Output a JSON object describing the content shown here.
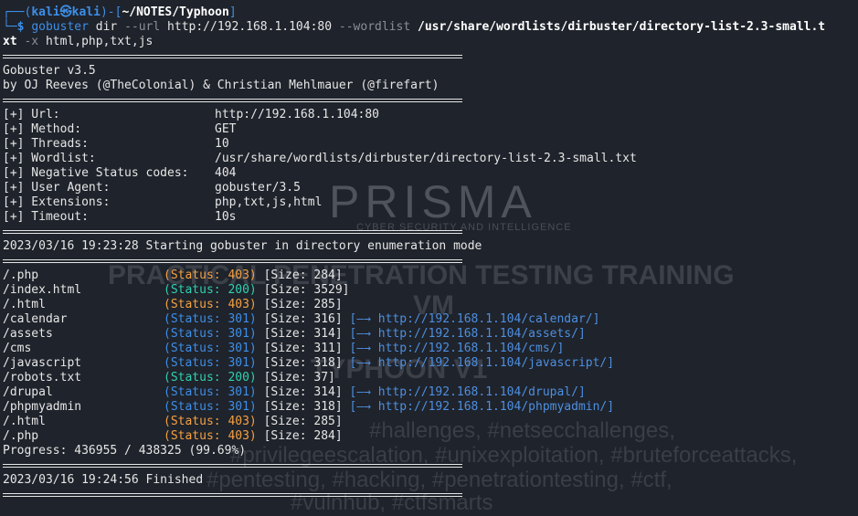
{
  "prompt": {
    "corner_top": "┌──(",
    "user": "kali",
    "at": "㉿",
    "host": "kali",
    "mid": ")-[",
    "path": "~/NOTES/Typhoon",
    "end": "]",
    "corner_bottom": "└─",
    "dollar": "$",
    "cmd": "gobuster",
    "arg1": "dir",
    "flag_url": "--url",
    "url": "http://192.168.1.104:80",
    "flag_wordlist": "--wordlist",
    "wordlist_part1": "/usr/share/wordlists/dirbuster/directory-list-2.3-small.t",
    "wordlist_part2": "xt",
    "flag_x": "-x",
    "ext": "html,php,txt,js"
  },
  "banner": {
    "version": "Gobuster v3.5",
    "authors": "by OJ Reeves (@TheColonial) & Christian Mehlmauer (@firefart)"
  },
  "config": [
    {
      "key": "[+] Url:",
      "value": "http://192.168.1.104:80"
    },
    {
      "key": "[+] Method:",
      "value": "GET"
    },
    {
      "key": "[+] Threads:",
      "value": "10"
    },
    {
      "key": "[+] Wordlist:",
      "value": "/usr/share/wordlists/dirbuster/directory-list-2.3-small.txt"
    },
    {
      "key": "[+] Negative Status codes:",
      "value": "404"
    },
    {
      "key": "[+] User Agent:",
      "value": "gobuster/3.5"
    },
    {
      "key": "[+] Extensions:",
      "value": "php,txt,js,html"
    },
    {
      "key": "[+] Timeout:",
      "value": "10s"
    }
  ],
  "start_msg": "2023/03/16 19:23:28 Starting gobuster in directory enumeration mode",
  "results": [
    {
      "path": "/.php",
      "status": "(Status: 403)",
      "size": "[Size: 284]",
      "code": "403",
      "redirect": ""
    },
    {
      "path": "/index.html",
      "status": "(Status: 200)",
      "size": "[Size: 3529]",
      "code": "200",
      "redirect": ""
    },
    {
      "path": "/.html",
      "status": "(Status: 403)",
      "size": "[Size: 285]",
      "code": "403",
      "redirect": ""
    },
    {
      "path": "/calendar",
      "status": "(Status: 301)",
      "size": "[Size: 316]",
      "code": "301",
      "redirect": "[—→ http://192.168.1.104/calendar/]"
    },
    {
      "path": "/assets",
      "status": "(Status: 301)",
      "size": "[Size: 314]",
      "code": "301",
      "redirect": "[—→ http://192.168.1.104/assets/]"
    },
    {
      "path": "/cms",
      "status": "(Status: 301)",
      "size": "[Size: 311]",
      "code": "301",
      "redirect": "[—→ http://192.168.1.104/cms/]"
    },
    {
      "path": "/javascript",
      "status": "(Status: 301)",
      "size": "[Size: 318]",
      "code": "301",
      "redirect": "[—→ http://192.168.1.104/javascript/]"
    },
    {
      "path": "/robots.txt",
      "status": "(Status: 200)",
      "size": "[Size: 37]",
      "code": "200",
      "redirect": ""
    },
    {
      "path": "/drupal",
      "status": "(Status: 301)",
      "size": "[Size: 314]",
      "code": "301",
      "redirect": "[—→ http://192.168.1.104/drupal/]"
    },
    {
      "path": "/phpmyadmin",
      "status": "(Status: 301)",
      "size": "[Size: 318]",
      "code": "301",
      "redirect": "[—→ http://192.168.1.104/phpmyadmin/]"
    },
    {
      "path": "/.html",
      "status": "(Status: 403)",
      "size": "[Size: 285]",
      "code": "403",
      "redirect": ""
    },
    {
      "path": "/.php",
      "status": "(Status: 403)",
      "size": "[Size: 284]",
      "code": "403",
      "redirect": ""
    }
  ],
  "progress": "Progress: 436955 / 438325 (99.69%)",
  "finished_msg": "2023/03/16 19:24:56 Finished",
  "watermark": {
    "logo": "PRISMA",
    "logo_sub": "CYBER SECURITY AND INTELLIGENCE",
    "line1": "PRACTICAL PENETRATION TESTING TRAINING",
    "line2": "VM",
    "line3": "TYPHOON V1",
    "tags1": "#hallenges, #netsecchallenges,",
    "tags2": "#privilegeescalation, #unixexploitation, #bruteforceattacks,",
    "tags3": "#pentesting, #hacking, #penetrationtesting, #ctf,",
    "tags4": "#vulnhub, #ctfsmarts"
  },
  "colors": {
    "background": "#1f232b",
    "status_200": "#2fd1b0",
    "status_301": "#3d8fe8",
    "status_403": "#f5a142",
    "prompt_blue": "#3d8fe8"
  }
}
